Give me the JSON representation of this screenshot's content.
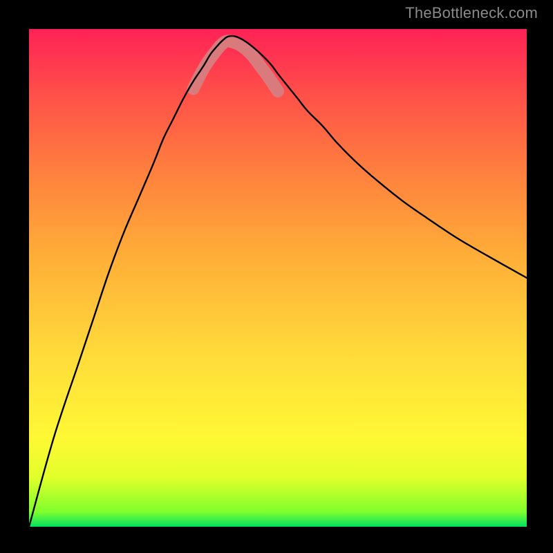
{
  "watermark": "TheBottleneck.com",
  "chart_data": {
    "type": "line",
    "title": "",
    "xlabel": "",
    "ylabel": "",
    "xlim": [
      0,
      100
    ],
    "ylim": [
      0,
      100
    ],
    "grid": false,
    "legend": false,
    "series": [
      {
        "name": "bottleneck-curve",
        "x": [
          0,
          5,
          10,
          13,
          16,
          19,
          22,
          25,
          27,
          29,
          31,
          33,
          35,
          36.5,
          38,
          39,
          40,
          41.5,
          43.5,
          46,
          48.5,
          50,
          52,
          54,
          56,
          59,
          62,
          66,
          70,
          75,
          80,
          86,
          92,
          100
        ],
        "y": [
          0,
          18,
          33,
          42,
          51,
          59,
          66,
          73,
          78,
          82,
          86,
          89.5,
          92.5,
          95,
          96.8,
          97.8,
          98.5,
          98.5,
          97.5,
          95.5,
          93,
          91,
          88.5,
          86,
          83.5,
          80.5,
          77,
          73,
          69.5,
          65.5,
          62,
          58,
          54.5,
          50
        ]
      },
      {
        "name": "optimal-band",
        "x": [
          33,
          34.5,
          36,
          37.5,
          38.5,
          39.5,
          40.5,
          42,
          43.5,
          45,
          46.5,
          48,
          49,
          50
        ],
        "y": [
          88,
          91,
          93.5,
          95.5,
          96.7,
          97.5,
          97.5,
          97,
          96,
          94.5,
          92.5,
          90.5,
          89,
          87.5
        ]
      }
    ],
    "background_gradient": {
      "type": "vertical",
      "stops": [
        {
          "offset": 0.0,
          "color": "#00e060"
        },
        {
          "offset": 0.03,
          "color": "#7fff2e"
        },
        {
          "offset": 0.1,
          "color": "#e2ff2a"
        },
        {
          "offset": 0.18,
          "color": "#fff835"
        },
        {
          "offset": 0.35,
          "color": "#ffda3a"
        },
        {
          "offset": 0.55,
          "color": "#ffac38"
        },
        {
          "offset": 0.72,
          "color": "#ff7e3e"
        },
        {
          "offset": 0.88,
          "color": "#ff4c4a"
        },
        {
          "offset": 1.0,
          "color": "#ff2157"
        }
      ]
    },
    "optimal_band_color": "#d97b7d",
    "curve_color": "#000000"
  }
}
